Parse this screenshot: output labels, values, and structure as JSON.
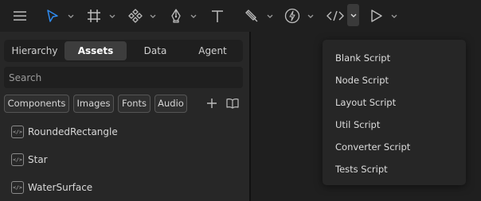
{
  "toolbar": {
    "tools": [
      {
        "icon": "menu-icon"
      },
      {
        "icon": "pointer-icon",
        "active": true
      },
      {
        "icon": "frame-icon"
      },
      {
        "icon": "components-icon"
      },
      {
        "icon": "pen-icon"
      },
      {
        "icon": "text-icon"
      },
      {
        "icon": "brush-icon"
      },
      {
        "icon": "lightning-icon"
      },
      {
        "icon": "code-icon"
      },
      {
        "icon": "play-icon"
      }
    ],
    "accent_color": "#2f8bf0"
  },
  "panel": {
    "tabs": [
      "Hierarchy",
      "Assets",
      "Data",
      "Agent"
    ],
    "active_tab": "Assets",
    "search_placeholder": "Search",
    "filters": [
      "Components",
      "Images",
      "Fonts",
      "Audio"
    ],
    "assets": [
      {
        "label": "RoundedRectangle",
        "icon": "script-file-icon"
      },
      {
        "label": "Star",
        "icon": "script-file-icon"
      },
      {
        "label": "WaterSurface",
        "icon": "script-file-icon"
      }
    ]
  },
  "script_menu": {
    "items": [
      "Blank Script",
      "Node Script",
      "Layout Script",
      "Util Script",
      "Converter Script",
      "Tests Script"
    ]
  }
}
